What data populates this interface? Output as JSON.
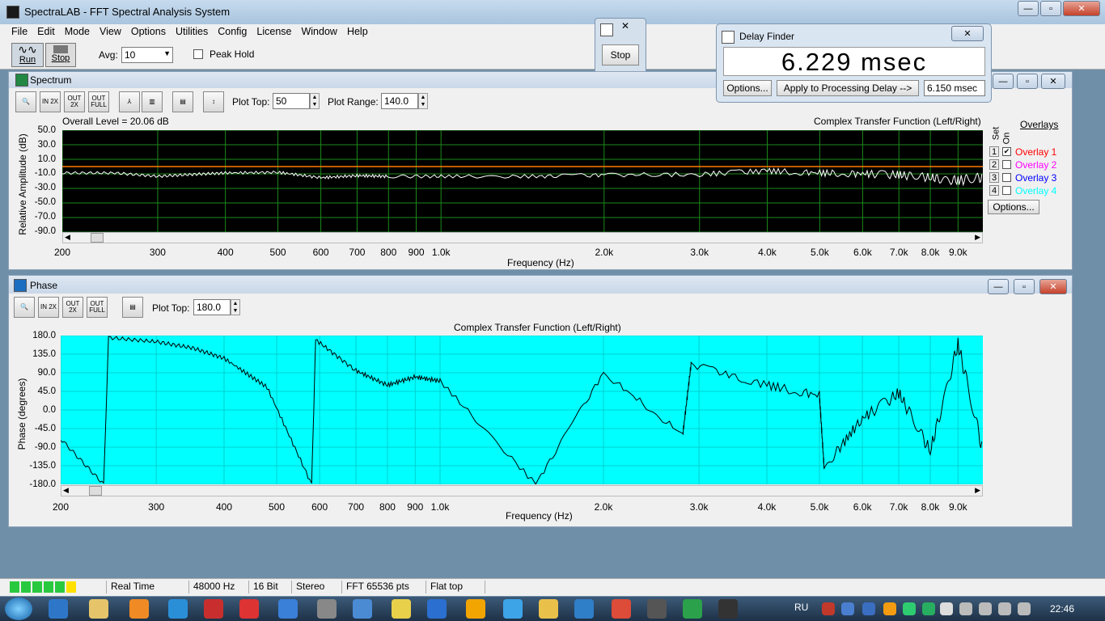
{
  "app": {
    "title": "SpectraLAB - FFT Spectral Analysis System"
  },
  "menu": [
    "File",
    "Edit",
    "Mode",
    "View",
    "Options",
    "Utilities",
    "Config",
    "License",
    "Window",
    "Help"
  ],
  "toolbar": {
    "run_label": "Run",
    "stop_label": "Stop",
    "avg_label": "Avg:",
    "avg_value": "10",
    "peak_hold_label": "Peak Hold",
    "peak_hold_checked": false
  },
  "stop_dialog": {
    "button": "Stop"
  },
  "delay_finder": {
    "title": "Delay Finder",
    "value": "6.229 msec",
    "options_button": "Options...",
    "apply_button": "Apply to Processing Delay -->",
    "processing_delay": "6.150 msec"
  },
  "spectrum": {
    "title": "Spectrum",
    "plot_top_label": "Plot Top:",
    "plot_top": "50",
    "plot_range_label": "Plot Range:",
    "plot_range": "140.0",
    "overall_level": "Overall Level = 20.06 dB",
    "chart_title": "Complex Transfer Function (Left/Right)",
    "ylabel": "Relative Amplitude (dB)",
    "xlabel": "Frequency (Hz)",
    "y_ticks": [
      "50.0",
      "30.0",
      "10.0",
      "-10.0",
      "-30.0",
      "-50.0",
      "-70.0",
      "-90.0"
    ],
    "x_ticks": [
      "200",
      "300",
      "400",
      "500",
      "600",
      "700",
      "800",
      "900",
      "1.0k",
      "2.0k",
      "3.0k",
      "4.0k",
      "5.0k",
      "6.0k",
      "7.0k",
      "8.0k",
      "9.0k"
    ],
    "overlays_label": "Overlays",
    "set_label": "Set",
    "on_label": "On",
    "overlays": [
      {
        "num": "1",
        "name": "Overlay 1",
        "color": "#ff0000",
        "checked": true
      },
      {
        "num": "2",
        "name": "Overlay 2",
        "color": "#ff00ff",
        "checked": false
      },
      {
        "num": "3",
        "name": "Overlay 3",
        "color": "#0000ff",
        "checked": false
      },
      {
        "num": "4",
        "name": "Overlay 4",
        "color": "#00ffff",
        "checked": false
      }
    ],
    "overlay_options": "Options..."
  },
  "phase": {
    "title": "Phase",
    "plot_top_label": "Plot Top:",
    "plot_top": "180.0",
    "chart_title": "Complex Transfer Function (Left/Right)",
    "ylabel": "Phase (degrees)",
    "xlabel": "Frequency (Hz)",
    "y_ticks": [
      "180.0",
      "135.0",
      "90.0",
      "45.0",
      "0.0",
      "-45.0",
      "-90.0",
      "-135.0",
      "-180.0"
    ],
    "x_ticks": [
      "200",
      "300",
      "400",
      "500",
      "600",
      "700",
      "800",
      "900",
      "1.0k",
      "2.0k",
      "3.0k",
      "4.0k",
      "5.0k",
      "6.0k",
      "7.0k",
      "8.0k",
      "9.0k"
    ]
  },
  "icons": {
    "zoom": "magnifier-icon",
    "in2x": "IN 2X",
    "out2x": "OUT 2X",
    "outfull": "OUT FULL"
  },
  "status": {
    "mode": "Real Time",
    "rate": "48000 Hz",
    "bits": "16 Bit",
    "channels": "Stereo",
    "fft": "FFT 65536 pts",
    "window": "Flat top"
  },
  "taskbar": {
    "lang": "RU",
    "time": "22:46"
  },
  "chart_data": [
    {
      "type": "line",
      "title": "Complex Transfer Function (Left/Right)",
      "xlabel": "Frequency (Hz)",
      "ylabel": "Relative Amplitude (dB)",
      "ylim": [
        -100,
        50
      ],
      "xscale": "log",
      "xlim": [
        200,
        10000
      ],
      "series": [
        {
          "values_x": [
            200,
            250,
            300,
            350,
            400,
            500,
            600,
            700,
            800,
            1000,
            1500,
            2000,
            3000,
            4000,
            5000,
            6000,
            7000,
            8000,
            9000,
            10000
          ],
          "values_y": [
            -13,
            -13,
            -18,
            -15,
            -13,
            -12,
            -20,
            -17,
            -18,
            -18,
            -18,
            -16,
            -15,
            -10,
            -13,
            -14,
            -16,
            -20,
            -24,
            -20
          ]
        }
      ]
    },
    {
      "type": "line",
      "title": "Complex Transfer Function (Left/Right)",
      "xlabel": "Frequency (Hz)",
      "ylabel": "Phase (degrees)",
      "ylim": [
        -180,
        180
      ],
      "xscale": "log",
      "xlim": [
        200,
        10000
      ],
      "series": [
        {
          "values_x": [
            200,
            240,
            245,
            300,
            350,
            400,
            480,
            580,
            590,
            700,
            800,
            900,
            1000,
            1500,
            2000,
            2800,
            2900,
            4000,
            5000,
            5100,
            6000,
            7000,
            8000,
            9000,
            10000
          ],
          "values_y": [
            -70,
            -180,
            175,
            165,
            150,
            125,
            55,
            -180,
            170,
            95,
            60,
            80,
            70,
            -180,
            90,
            -60,
            110,
            60,
            35,
            -140,
            -20,
            40,
            -100,
            160,
            -100
          ]
        }
      ]
    }
  ]
}
